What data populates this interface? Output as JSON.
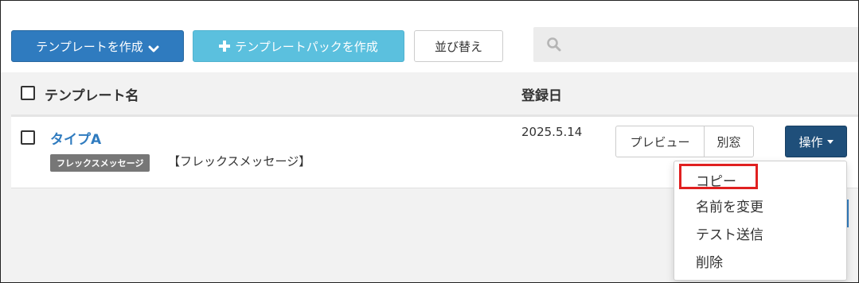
{
  "toolbar": {
    "create_label": "テンプレートを作成",
    "create_pack_label": "テンプレートパックを作成",
    "sort_label": "並び替え",
    "search_placeholder": ""
  },
  "table": {
    "headers": {
      "name": "テンプレート名",
      "date": "登録日"
    },
    "rows": [
      {
        "title": "タイプA",
        "badge": "フレックスメッセージ",
        "type_text": "【フレックスメッセージ】",
        "date": "2025.5.14",
        "preview_label": "プレビュー",
        "window_label": "別窓",
        "ops_label": "操作"
      }
    ]
  },
  "dropdown": {
    "items": [
      "コピー",
      "名前を変更",
      "テスト送信",
      "削除"
    ],
    "highlighted_index": 0
  },
  "colors": {
    "primary": "#2f7bbf",
    "info": "#5bc0de",
    "dark": "#1f4f7a",
    "highlight": "#e02020",
    "badge": "#777777"
  },
  "icons": {
    "create_chevron": "chevron-down-icon",
    "pack_plus": "plus-icon",
    "search": "search-icon",
    "ops_caret": "caret-down-icon"
  }
}
